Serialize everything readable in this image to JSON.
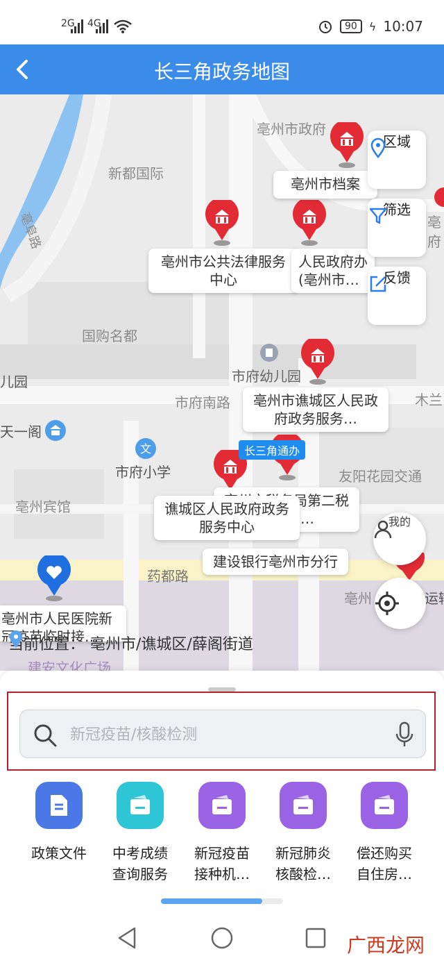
{
  "status_bar": {
    "signal1": "2G",
    "signal2": "4G",
    "battery": "90",
    "time": "10:07"
  },
  "header": {
    "title": "长三角政务地图"
  },
  "map": {
    "labels": [
      "亳州市政府",
      "新都国际",
      "亳阜路",
      "国购名都",
      "市府幼儿园",
      "儿园",
      "市府南路",
      "天一阁",
      "市府小学",
      "亳州宾馆",
      "药都路",
      "友阳花园交通",
      "木兰",
      "建安文化广场",
      "亳",
      "府",
      "亳州",
      "运输"
    ],
    "poi_cards": [
      {
        "text": "亳州市档案"
      },
      {
        "text": "亳州市公共法律服务中心",
        "sub": "服务…"
      },
      {
        "text": "人民政府办(亳州市…"
      },
      {
        "text": "亳州市谯城区人民政府政务服务…"
      },
      {
        "text": "谯城区人民政府政务服务中心"
      },
      {
        "text": "亳州市税务局第二税务分局…"
      },
      {
        "text": "建设银行亳州市分行"
      },
      {
        "text": "亳州市人民医院新冠疫苗临时接…"
      }
    ],
    "badge": "长三角通办",
    "controls": {
      "region": "区域",
      "filter": "筛选",
      "feedback": "反馈",
      "mine": "我的"
    },
    "current_location_label": "当前位置：",
    "current_location": "亳州市/谯城区/薛阁街道"
  },
  "search": {
    "placeholder": "新冠疫苗/核酸检测"
  },
  "services": [
    {
      "line1": "政策文件",
      "line2": "",
      "color": "#4a78e6",
      "icon": "document-icon"
    },
    {
      "line1": "中考成绩",
      "line2": "查询服务",
      "color": "#2ec6d6",
      "icon": "card-icon"
    },
    {
      "line1": "新冠疫苗",
      "line2": "接种机…",
      "color": "#9a63e6",
      "icon": "card-icon"
    },
    {
      "line1": "新冠肺炎",
      "line2": "核酸检…",
      "color": "#9a63e6",
      "icon": "card-icon"
    },
    {
      "line1": "偿还购买",
      "line2": "自住房…",
      "color": "#9a63e6",
      "icon": "card-icon"
    }
  ],
  "scroll_progress": 0.83,
  "watermark": "广西龙网",
  "colors": {
    "header": "#3b8ce8",
    "pin": "#e22b35",
    "highlight": "#b5202e"
  }
}
